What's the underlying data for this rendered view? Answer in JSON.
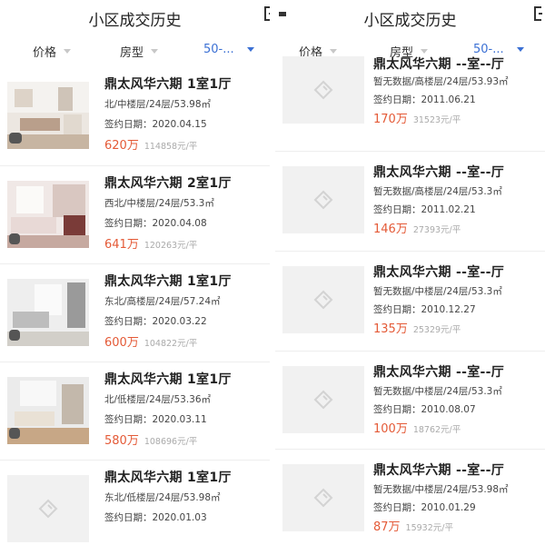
{
  "left": {
    "title": "小区成交历史",
    "filters": {
      "price": "价格",
      "layout": "房型",
      "area": "50-..."
    },
    "items": [
      {
        "title": "鼎太风华六期 1室1厅",
        "detail": "北/中楼层/24层/53.98㎡",
        "date": "签约日期：2020.04.15",
        "price": "620万",
        "unit_price": "114858元/平"
      },
      {
        "title": "鼎太风华六期 2室1厅",
        "detail": "西北/中楼层/24层/53.3㎡",
        "date": "签约日期：2020.04.08",
        "price": "641万",
        "unit_price": "120263元/平"
      },
      {
        "title": "鼎太风华六期 1室1厅",
        "detail": "东北/高楼层/24层/57.24㎡",
        "date": "签约日期：2020.03.22",
        "price": "600万",
        "unit_price": "104822元/平"
      },
      {
        "title": "鼎太风华六期 1室1厅",
        "detail": "北/低楼层/24层/53.36㎡",
        "date": "签约日期：2020.03.11",
        "price": "580万",
        "unit_price": "108696元/平"
      },
      {
        "title": "鼎太风华六期 1室1厅",
        "detail": "东北/低楼层/24层/53.98㎡",
        "date": "签约日期：2020.01.03",
        "price": "",
        "unit_price": ""
      }
    ]
  },
  "right": {
    "title": "小区成交历史",
    "filters": {
      "price": "价格",
      "layout": "房型",
      "area": "50-..."
    },
    "items": [
      {
        "title": "鼎太风华六期 --室--厅",
        "detail": "暂无数据/高楼层/24层/53.93㎡",
        "date": "签约日期：2011.06.21",
        "price": "170万",
        "unit_price": "31523元/平"
      },
      {
        "title": "鼎太风华六期 --室--厅",
        "detail": "暂无数据/高楼层/24层/53.3㎡",
        "date": "签约日期：2011.02.21",
        "price": "146万",
        "unit_price": "27393元/平"
      },
      {
        "title": "鼎太风华六期 --室--厅",
        "detail": "暂无数据/中楼层/24层/53.3㎡",
        "date": "签约日期：2010.12.27",
        "price": "135万",
        "unit_price": "25329元/平"
      },
      {
        "title": "鼎太风华六期 --室--厅",
        "detail": "暂无数据/中楼层/24层/53.3㎡",
        "date": "签约日期：2010.08.07",
        "price": "100万",
        "unit_price": "18762元/平"
      },
      {
        "title": "鼎太风华六期 --室--厅",
        "detail": "暂无数据/中楼层/24层/53.98㎡",
        "date": "签约日期：2010.01.29",
        "price": "87万",
        "unit_price": "15932元/平"
      }
    ]
  },
  "colors": {
    "price": "#e45a37",
    "active_filter": "#3b70d4",
    "muted": "#aaaaaa"
  },
  "icons": {
    "placeholder": "house-placeholder-icon",
    "top_right": "square-bracket-icon"
  }
}
